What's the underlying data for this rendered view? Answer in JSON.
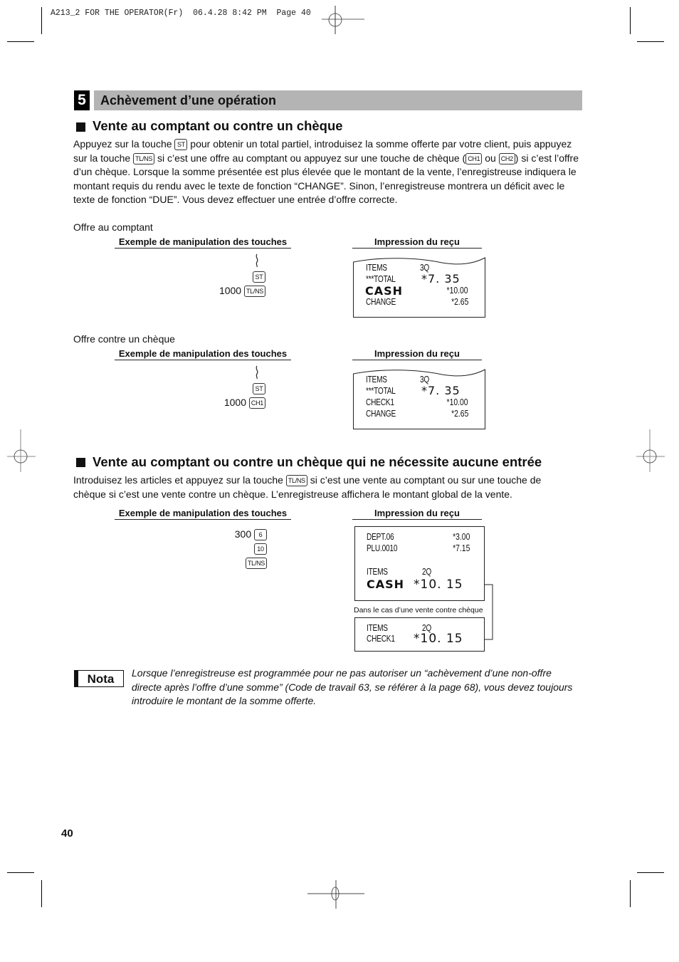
{
  "slug": "A213_2 FOR THE OPERATOR(Fr)  06.4.28 8:42 PM  Page 40",
  "section": {
    "number": "5",
    "title": "Achèvement d’une opération"
  },
  "subsection1": {
    "title": "Vente au comptant ou contre un chèque",
    "paragraph": [
      {
        "t": "Appuyez sur la touche "
      },
      {
        "k": "ST"
      },
      {
        "t": " pour obtenir un total partiel, introduisez la somme offerte par votre client, puis appuyez sur la touche "
      },
      {
        "k": "TL/NS"
      },
      {
        "t": " si c’est une offre au comptant ou appuyez sur une touche de chèque ("
      },
      {
        "k": "CH1"
      },
      {
        "t": " ou "
      },
      {
        "k": "CH2"
      },
      {
        "t": ") si c’est l’offre d’un chèque. Lorsque la somme présentée est plus élevée que le montant de la vente, l’enregistreuse indiquera le montant requis du rendu avec le texte de fonction “CHANGE”. Sinon, l’enregistreuse montrera un déficit avec le texte de fonction “DUE”. Vous devez effectuer une entrée d’offre correcte."
      }
    ],
    "examples": [
      {
        "label": "Offre au comptant",
        "keys_heading": "Exemple de manipulation des touches",
        "receipt_heading": "Impression du reçu",
        "key_sequence": [
          {
            "amount": "",
            "key": "ST"
          },
          {
            "amount": "1000",
            "key": "TL/NS"
          }
        ],
        "receipt": [
          {
            "label": "ITEMS",
            "qty": "3Q",
            "value": "",
            "big_label": false,
            "big_value": false
          },
          {
            "label": "***TOTAL",
            "qty": "",
            "value": "*7. 35",
            "big_label": false,
            "big_value": true
          },
          {
            "label": "CASH",
            "qty": "",
            "value": "*10.00",
            "big_label": true,
            "big_value": false
          },
          {
            "label": "CHANGE",
            "qty": "",
            "value": "*2.65",
            "big_label": false,
            "big_value": false
          }
        ]
      },
      {
        "label": "Offre contre un chèque",
        "keys_heading": "Exemple de manipulation des touches",
        "receipt_heading": "Impression du reçu",
        "key_sequence": [
          {
            "amount": "",
            "key": "ST"
          },
          {
            "amount": "1000",
            "key": "CH1"
          }
        ],
        "receipt": [
          {
            "label": "ITEMS",
            "qty": "3Q",
            "value": "",
            "big_label": false,
            "big_value": false
          },
          {
            "label": "***TOTAL",
            "qty": "",
            "value": "*7. 35",
            "big_label": false,
            "big_value": true
          },
          {
            "label": "CHECK1",
            "qty": "",
            "value": "*10.00",
            "big_label": false,
            "big_value": false
          },
          {
            "label": "CHANGE",
            "qty": "",
            "value": "*2.65",
            "big_label": false,
            "big_value": false
          }
        ]
      }
    ]
  },
  "subsection2": {
    "title": "Vente au comptant ou contre un chèque qui ne nécessite aucune entrée",
    "paragraph": [
      {
        "t": "Introduisez les articles et appuyez sur la touche "
      },
      {
        "k": "TL/NS"
      },
      {
        "t": " si c’est une vente au comptant ou sur une touche de chèque si c’est une vente contre un chèque. L’enregistreuse affichera le montant global de la vente."
      }
    ],
    "keys_heading": "Exemple de manipulation des touches",
    "receipt_heading": "Impression du reçu",
    "key_sequence": [
      {
        "amount": "300",
        "key": "6"
      },
      {
        "amount": "",
        "key": "10"
      },
      {
        "amount": "",
        "key": "TL/NS"
      }
    ],
    "receipt_cash": [
      {
        "label": "DEPT.06",
        "qty": "",
        "value": "*3.00"
      },
      {
        "label": "PLU.0010",
        "qty": "",
        "value": "*7.15"
      },
      {
        "label": "ITEMS",
        "qty": "2Q",
        "value": ""
      },
      {
        "label": "CASH",
        "qty": "",
        "value": "*10. 15"
      }
    ],
    "check_caption": "Dans le cas d’une vente contre chèque",
    "receipt_check": [
      {
        "label": "ITEMS",
        "qty": "2Q",
        "value": ""
      },
      {
        "label": "CHECK1",
        "qty": "",
        "value": "*10. 15"
      }
    ]
  },
  "nota": {
    "label": "Nota",
    "text": "Lorsque l’enregistreuse est programmée pour ne pas autoriser un “achèvement d’une non-offre directe après l’offre d’une somme” (Code de travail 63, se référer à la page 68), vous devez toujours introduire le montant de la somme offerte."
  },
  "page_number": "40"
}
